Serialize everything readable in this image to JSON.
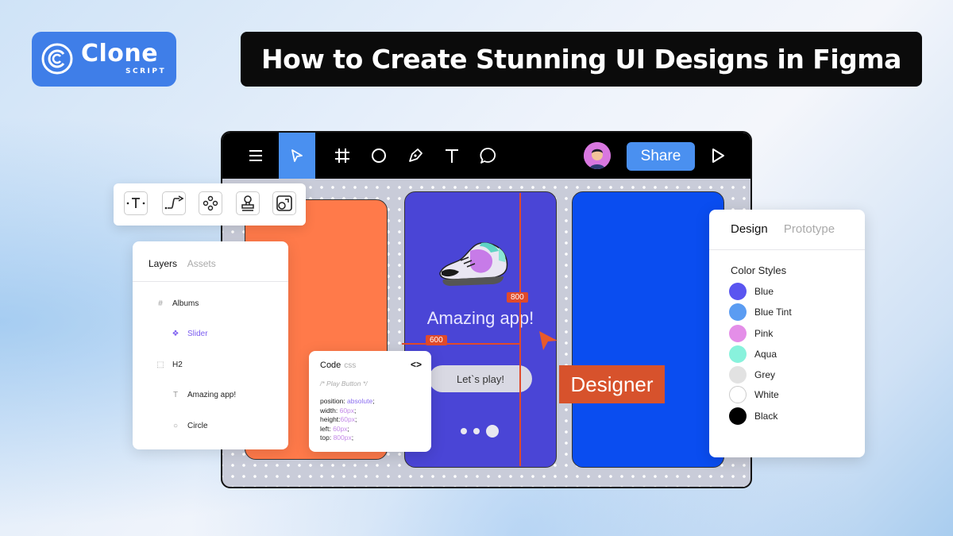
{
  "brand": {
    "name": "Clone",
    "sub": "SCRIPT",
    "color": "#3f7ee8"
  },
  "headline": "How to Create Stunning UI Designs in Figma",
  "toolbar": {
    "icons": [
      "menu-icon",
      "cursor-icon",
      "frame-icon",
      "ellipse-icon",
      "pen-icon",
      "text-icon",
      "comment-icon"
    ],
    "active": "cursor-icon",
    "share_label": "Share",
    "accent": "#4a90f0"
  },
  "canvas": {
    "app_text": "Amazing app!",
    "play_button": "Let`s play!",
    "measure_h": "600",
    "measure_v": "800",
    "frame_colors": [
      "#ff7a4a",
      "#4a45d6",
      "#0a4df0"
    ]
  },
  "layers_panel": {
    "tabs": [
      "Layers",
      "Assets"
    ],
    "items": [
      {
        "icon": "#",
        "label": "Albums"
      },
      {
        "icon": "❖",
        "label": "Slider"
      },
      {
        "icon": "⬚",
        "label": "H2"
      },
      {
        "icon": "T",
        "label": "Amazing app!"
      },
      {
        "icon": "○",
        "label": "Circle"
      }
    ]
  },
  "code_panel": {
    "title": "Code",
    "lang": "css",
    "toggle": "<>",
    "comment": "/* Play Button */",
    "lines": [
      {
        "prop": "position:",
        "value": "absolute",
        "end": ";"
      },
      {
        "prop": "width:",
        "value": "60px",
        "end": ";"
      },
      {
        "prop": "height:",
        "value": "60px",
        "end": ";"
      },
      {
        "prop": "left:",
        "value": "60px",
        "end": ";"
      },
      {
        "prop": "top:",
        "value": "800px",
        "end": ";"
      }
    ]
  },
  "designer_tag": "Designer",
  "design_panel": {
    "tabs": [
      "Design",
      "Prototype"
    ],
    "section_title": "Color Styles",
    "colors": [
      {
        "name": "Blue",
        "hex": "#5a55f0"
      },
      {
        "name": "Blue Tint",
        "hex": "#5b9cf2"
      },
      {
        "name": "Pink",
        "hex": "#e48ee8"
      },
      {
        "name": "Aqua",
        "hex": "#88f2dc"
      },
      {
        "name": "Grey",
        "hex": "#e2e2e2"
      },
      {
        "name": "White",
        "hex": "#ffffff"
      },
      {
        "name": "Black",
        "hex": "#000000"
      }
    ]
  }
}
